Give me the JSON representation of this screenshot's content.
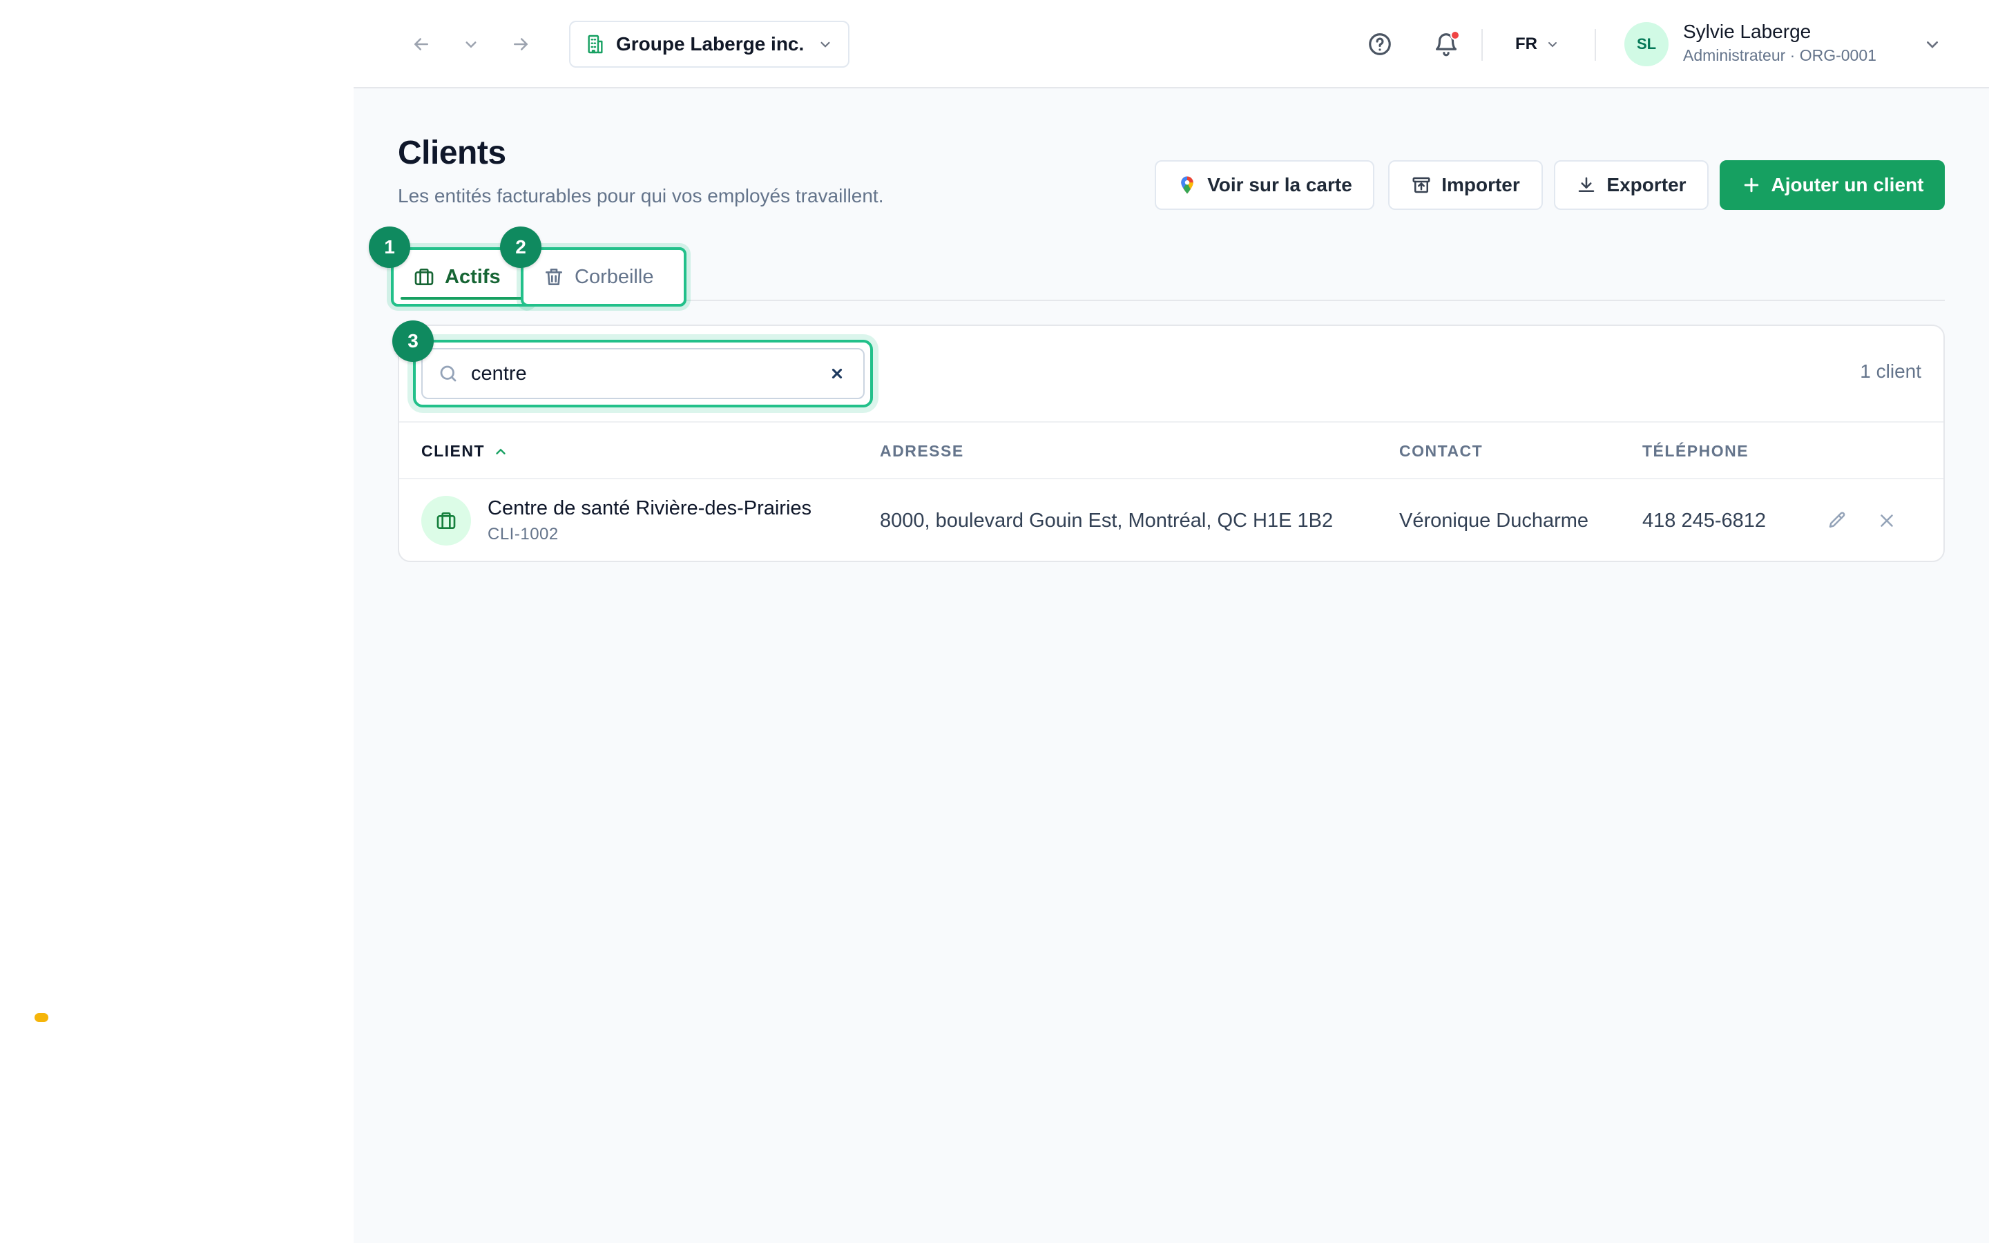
{
  "header": {
    "org_name": "Groupe Laberge inc.",
    "language": "FR",
    "user": {
      "initials": "SL",
      "name": "Sylvie Laberge",
      "role": "Administrateur · ORG-0001"
    },
    "notification_color": "#ef4444"
  },
  "page": {
    "title": "Clients",
    "subtitle": "Les entités facturables pour qui vos employés travaillent."
  },
  "actions": {
    "map": "Voir sur la carte",
    "import": "Importer",
    "export": "Exporter",
    "add": "Ajouter un client"
  },
  "tabs": [
    {
      "label": "Actifs",
      "icon": "briefcase-icon",
      "active": true
    },
    {
      "label": "Corbeille",
      "icon": "trash-icon",
      "active": false
    }
  ],
  "markers": [
    "1",
    "2",
    "3"
  ],
  "search": {
    "value": "centre",
    "count": "1 client"
  },
  "table": {
    "columns": [
      "CLIENT",
      "ADRESSE",
      "CONTACT",
      "TÉLÉPHONE"
    ],
    "sorted_column": "CLIENT",
    "rows": [
      {
        "name": "Centre de santé Rivière-des-Prairies",
        "code": "CLI-1002",
        "address": "8000, boulevard Gouin Est, Montréal, QC H1E 1B2",
        "contact": "Véronique Ducharme",
        "phone": "418 245-6812"
      }
    ]
  },
  "colors": {
    "primary": "#16a061",
    "highlight": "#22c08a",
    "marker": "#0f8a5f"
  }
}
